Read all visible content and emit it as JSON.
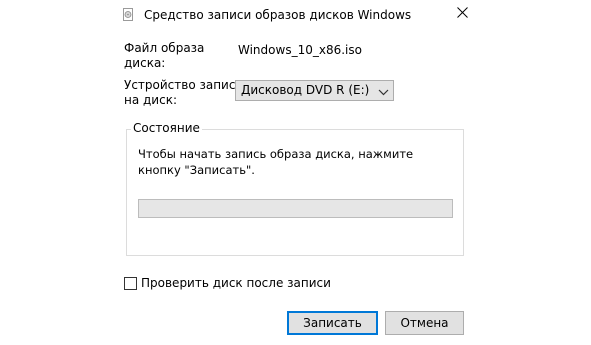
{
  "window": {
    "title": "Средство записи образов дисков Windows"
  },
  "image_file": {
    "label": "Файл образа\nдиска:",
    "value": "Windows_10_x86.iso"
  },
  "burner": {
    "label": "Устройство записи\nна диск:",
    "selected": "Дисковод DVD R (E:)"
  },
  "status": {
    "legend": "Состояние",
    "message": "Чтобы начать запись образа диска, нажмите кнопку \"Записать\".",
    "progress": 0
  },
  "verify": {
    "label": "Проверить диск после записи",
    "checked": false
  },
  "buttons": {
    "burn": "Записать",
    "cancel": "Отмена"
  },
  "colors": {
    "accent": "#0078d7",
    "progress_fill": "#06b025"
  },
  "icons": {
    "app": "disc-image-icon",
    "close": "close-icon",
    "dropdown": "chevron-down-icon"
  }
}
